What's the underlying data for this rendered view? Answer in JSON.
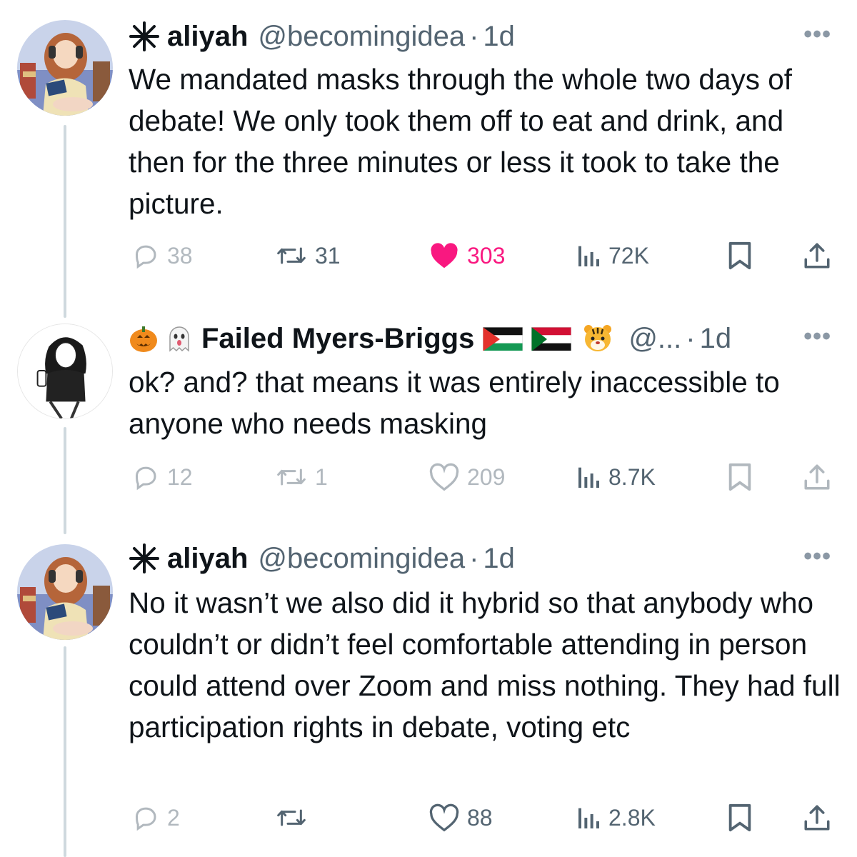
{
  "tweets": [
    {
      "name": "aliyah",
      "handle": "@becomingidea",
      "time": "1d",
      "text": "We mandated masks through the whole two days of debate! We only took them off to eat and drink, and then for the three minutes or less it took to take the picture.",
      "replies": "38",
      "retweets": "31",
      "likes": "303",
      "views": "72K",
      "liked": true
    },
    {
      "name": "Failed Myers-Briggs",
      "handle": "@...",
      "time": "1d",
      "text": "ok? and? that means it was entirely inaccessible to anyone who needs masking",
      "replies": "12",
      "retweets": "1",
      "likes": "209",
      "views": "8.7K",
      "liked": false
    },
    {
      "name": "aliyah",
      "handle": "@becomingidea",
      "time": "1d",
      "text": "No it wasn’t we also did it hybrid so that anybody who couldn’t or didn’t feel comfortable attending in person could attend over Zoom and miss nothing. They had full participation rights in debate, voting etc",
      "replies": "2",
      "retweets": "",
      "likes": "88",
      "views": "2.8K",
      "liked": false
    }
  ],
  "ui": {
    "more_label": "•••",
    "dot": "·",
    "like_color": "#f91880",
    "muted_color": "#536471",
    "thread_line_color": "#cfd9de",
    "icons": [
      "reply-icon",
      "retweet-icon",
      "like-icon",
      "views-icon",
      "bookmark-icon",
      "share-icon",
      "more-icon",
      "asterisk-icon",
      "pumpkin-emoji",
      "ghost-emoji",
      "tiger-emoji",
      "palestine-flag",
      "sudan-flag"
    ]
  }
}
